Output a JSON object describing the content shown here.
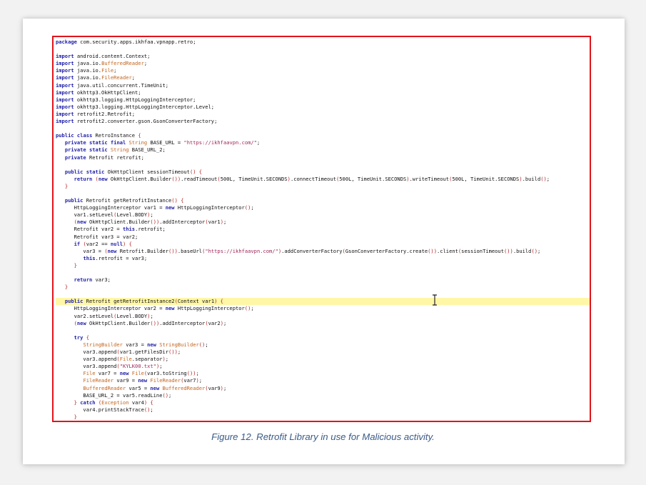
{
  "code_lines": [
    "package com.security.apps.ikhfaa.vpnapp.retro;",
    "",
    "import android.content.Context;",
    "import java.io.BufferedReader;",
    "import java.io.File;",
    "import java.io.FileReader;",
    "import java.util.concurrent.TimeUnit;",
    "import okhttp3.OkHttpClient;",
    "import okhttp3.logging.HttpLoggingInterceptor;",
    "import okhttp3.logging.HttpLoggingInterceptor.Level;",
    "import retrofit2.Retrofit;",
    "import retrofit2.converter.gson.GsonConverterFactory;",
    "",
    "public class RetroInstance {",
    "   private static final String BASE_URL = \"https://ikhfaavpn.com/\";",
    "   private static String BASE_URL_2;",
    "   private Retrofit retrofit;",
    "",
    "   public static OkHttpClient sessionTimeout() {",
    "      return (new OkHttpClient.Builder()).readTimeout(500L, TimeUnit.SECONDS).connectTimeout(500L, TimeUnit.SECONDS).writeTimeout(500L, TimeUnit.SECONDS).build();",
    "   }",
    "",
    "   public Retrofit getRetrofitInstance() {",
    "      HttpLoggingInterceptor var1 = new HttpLoggingInterceptor();",
    "      var1.setLevel(Level.BODY);",
    "      (new OkHttpClient.Builder()).addInterceptor(var1);",
    "      Retrofit var2 = this.retrofit;",
    "      Retrofit var3 = var2;",
    "      if (var2 == null) {",
    "         var3 = (new Retrofit.Builder()).baseUrl(\"https://ikhfaavpn.com/\").addConverterFactory(GsonConverterFactory.create()).client(sessionTimeout()).build();",
    "         this.retrofit = var3;",
    "      }",
    "",
    "      return var3;",
    "   }",
    "",
    "   public Retrofit getRetrofitInstance2(Context var1) {",
    "      HttpLoggingInterceptor var2 = new HttpLoggingInterceptor();",
    "      var2.setLevel(Level.BODY);",
    "      (new OkHttpClient.Builder()).addInterceptor(var2);",
    "",
    "      try {",
    "         StringBuilder var3 = new StringBuilder();",
    "         var3.append(var1.getFilesDir());",
    "         var3.append(File.separator);",
    "         var3.append(\"KYLK00.txt\");",
    "         File var7 = new File(var3.toString());",
    "         FileReader var9 = new FileReader(var7);",
    "         BufferedReader var5 = new BufferedReader(var9);",
    "         BASE_URL_2 = var5.readLine();",
    "      } catch (Exception var4) {",
    "         var4.printStackTrace();",
    "      }"
  ],
  "highlighted_line": 36,
  "caption": "Figure 12. Retrofit Library in use for Malicious activity.",
  "colors": {
    "keyword": "#1f1fa8",
    "type": "#c2641e",
    "string": "#a0285a",
    "frame": "#e0141b",
    "caption": "#3b5b86",
    "highlight": "#fff7a6"
  }
}
